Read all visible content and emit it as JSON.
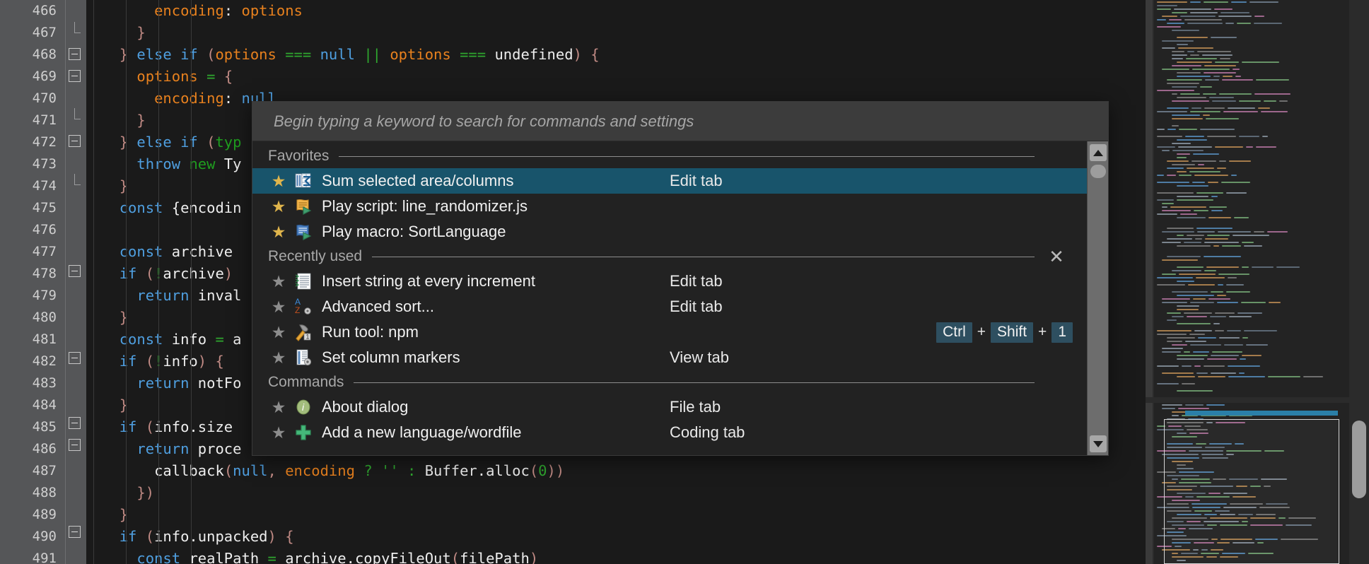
{
  "editor": {
    "first_line_number": 466,
    "lines": [
      {
        "n": 466,
        "fold": "none",
        "tokens": [
          {
            "t": "      ",
            "c": "plain"
          },
          {
            "t": "encoding",
            "c": "prop"
          },
          {
            "t": ": ",
            "c": "plain"
          },
          {
            "t": "options",
            "c": "prop"
          }
        ]
      },
      {
        "n": 467,
        "fold": "tick",
        "tokens": [
          {
            "t": "    ",
            "c": "plain"
          },
          {
            "t": "}",
            "c": "punc"
          }
        ]
      },
      {
        "n": 468,
        "fold": "box",
        "tokens": [
          {
            "t": "  ",
            "c": "plain"
          },
          {
            "t": "}",
            "c": "punc"
          },
          {
            "t": " ",
            "c": "plain"
          },
          {
            "t": "else",
            "c": "kw"
          },
          {
            "t": " ",
            "c": "plain"
          },
          {
            "t": "if",
            "c": "kw"
          },
          {
            "t": " ",
            "c": "plain"
          },
          {
            "t": "(",
            "c": "punc"
          },
          {
            "t": "options",
            "c": "prop"
          },
          {
            "t": " ",
            "c": "plain"
          },
          {
            "t": "===",
            "c": "op"
          },
          {
            "t": " ",
            "c": "plain"
          },
          {
            "t": "null",
            "c": "kw"
          },
          {
            "t": " ",
            "c": "plain"
          },
          {
            "t": "||",
            "c": "op"
          },
          {
            "t": " ",
            "c": "plain"
          },
          {
            "t": "options",
            "c": "prop"
          },
          {
            "t": " ",
            "c": "plain"
          },
          {
            "t": "===",
            "c": "op"
          },
          {
            "t": " ",
            "c": "plain"
          },
          {
            "t": "undefined",
            "c": "plain"
          },
          {
            "t": ")",
            "c": "punc"
          },
          {
            "t": " ",
            "c": "plain"
          },
          {
            "t": "{",
            "c": "punc"
          }
        ]
      },
      {
        "n": 469,
        "fold": "box",
        "tokens": [
          {
            "t": "    ",
            "c": "plain"
          },
          {
            "t": "options",
            "c": "prop"
          },
          {
            "t": " ",
            "c": "plain"
          },
          {
            "t": "=",
            "c": "op"
          },
          {
            "t": " ",
            "c": "plain"
          },
          {
            "t": "{",
            "c": "punc"
          }
        ]
      },
      {
        "n": 470,
        "fold": "none",
        "tokens": [
          {
            "t": "      ",
            "c": "plain"
          },
          {
            "t": "encoding",
            "c": "prop"
          },
          {
            "t": ": ",
            "c": "plain"
          },
          {
            "t": "null",
            "c": "kw"
          }
        ]
      },
      {
        "n": 471,
        "fold": "tick",
        "tokens": [
          {
            "t": "    ",
            "c": "plain"
          },
          {
            "t": "}",
            "c": "punc"
          }
        ]
      },
      {
        "n": 472,
        "fold": "box",
        "tokens": [
          {
            "t": "  ",
            "c": "plain"
          },
          {
            "t": "}",
            "c": "punc"
          },
          {
            "t": " ",
            "c": "plain"
          },
          {
            "t": "else",
            "c": "kw"
          },
          {
            "t": " ",
            "c": "plain"
          },
          {
            "t": "if",
            "c": "kw"
          },
          {
            "t": " ",
            "c": "plain"
          },
          {
            "t": "(",
            "c": "punc"
          },
          {
            "t": "typ",
            "c": "grn"
          }
        ]
      },
      {
        "n": 473,
        "fold": "none",
        "tokens": [
          {
            "t": "    ",
            "c": "plain"
          },
          {
            "t": "throw",
            "c": "kw"
          },
          {
            "t": " ",
            "c": "plain"
          },
          {
            "t": "new",
            "c": "grn"
          },
          {
            "t": " ",
            "c": "plain"
          },
          {
            "t": "Ty",
            "c": "plain"
          }
        ]
      },
      {
        "n": 474,
        "fold": "tick",
        "tokens": [
          {
            "t": "  ",
            "c": "plain"
          },
          {
            "t": "}",
            "c": "punc"
          }
        ]
      },
      {
        "n": 475,
        "fold": "none",
        "tokens": [
          {
            "t": "  ",
            "c": "plain"
          },
          {
            "t": "const",
            "c": "kw"
          },
          {
            "t": " ",
            "c": "plain"
          },
          {
            "t": "{encodin",
            "c": "plain"
          }
        ]
      },
      {
        "n": 476,
        "fold": "none",
        "tokens": []
      },
      {
        "n": 477,
        "fold": "none",
        "tokens": [
          {
            "t": "  ",
            "c": "plain"
          },
          {
            "t": "const",
            "c": "kw"
          },
          {
            "t": " ",
            "c": "plain"
          },
          {
            "t": "archive",
            "c": "plain"
          }
        ]
      },
      {
        "n": 478,
        "fold": "box",
        "tokens": [
          {
            "t": "  ",
            "c": "plain"
          },
          {
            "t": "if",
            "c": "kw"
          },
          {
            "t": " ",
            "c": "plain"
          },
          {
            "t": "(",
            "c": "punc"
          },
          {
            "t": "!",
            "c": "op"
          },
          {
            "t": "archive",
            "c": "plain"
          },
          {
            "t": ")",
            "c": "punc"
          }
        ]
      },
      {
        "n": 479,
        "fold": "none",
        "tokens": [
          {
            "t": "    ",
            "c": "plain"
          },
          {
            "t": "return",
            "c": "kw"
          },
          {
            "t": " ",
            "c": "plain"
          },
          {
            "t": "inval",
            "c": "plain"
          }
        ]
      },
      {
        "n": 480,
        "fold": "none",
        "tokens": [
          {
            "t": "  ",
            "c": "plain"
          },
          {
            "t": "}",
            "c": "punc"
          }
        ]
      },
      {
        "n": 481,
        "fold": "none",
        "tokens": [
          {
            "t": "  ",
            "c": "plain"
          },
          {
            "t": "const",
            "c": "kw"
          },
          {
            "t": " ",
            "c": "plain"
          },
          {
            "t": "info",
            "c": "plain"
          },
          {
            "t": " ",
            "c": "plain"
          },
          {
            "t": "=",
            "c": "op"
          },
          {
            "t": " ",
            "c": "plain"
          },
          {
            "t": "a",
            "c": "plain"
          }
        ]
      },
      {
        "n": 482,
        "fold": "box",
        "tokens": [
          {
            "t": "  ",
            "c": "plain"
          },
          {
            "t": "if",
            "c": "kw"
          },
          {
            "t": " ",
            "c": "plain"
          },
          {
            "t": "(",
            "c": "punc"
          },
          {
            "t": "!",
            "c": "op"
          },
          {
            "t": "info",
            "c": "plain"
          },
          {
            "t": ")",
            "c": "punc"
          },
          {
            "t": " ",
            "c": "plain"
          },
          {
            "t": "{",
            "c": "punc"
          }
        ]
      },
      {
        "n": 483,
        "fold": "none",
        "tokens": [
          {
            "t": "    ",
            "c": "plain"
          },
          {
            "t": "return",
            "c": "kw"
          },
          {
            "t": " ",
            "c": "plain"
          },
          {
            "t": "notFo",
            "c": "plain"
          }
        ]
      },
      {
        "n": 484,
        "fold": "none",
        "tokens": [
          {
            "t": "  ",
            "c": "plain"
          },
          {
            "t": "}",
            "c": "punc"
          }
        ]
      },
      {
        "n": 485,
        "fold": "box",
        "tokens": [
          {
            "t": "  ",
            "c": "plain"
          },
          {
            "t": "if",
            "c": "kw"
          },
          {
            "t": " ",
            "c": "plain"
          },
          {
            "t": "(",
            "c": "punc"
          },
          {
            "t": "info.size",
            "c": "plain"
          }
        ]
      },
      {
        "n": 486,
        "fold": "box",
        "tokens": [
          {
            "t": "    ",
            "c": "plain"
          },
          {
            "t": "return",
            "c": "kw"
          },
          {
            "t": " ",
            "c": "plain"
          },
          {
            "t": "proce",
            "c": "plain"
          }
        ]
      },
      {
        "n": 487,
        "fold": "none",
        "tokens": [
          {
            "t": "      ",
            "c": "plain"
          },
          {
            "t": "callback",
            "c": "plain"
          },
          {
            "t": "(",
            "c": "punc"
          },
          {
            "t": "null",
            "c": "kw"
          },
          {
            "t": ", ",
            "c": "punc"
          },
          {
            "t": "encoding",
            "c": "prop"
          },
          {
            "t": " ",
            "c": "plain"
          },
          {
            "t": "?",
            "c": "op"
          },
          {
            "t": " ",
            "c": "plain"
          },
          {
            "t": "''",
            "c": "str"
          },
          {
            "t": " ",
            "c": "plain"
          },
          {
            "t": ":",
            "c": "op"
          },
          {
            "t": " ",
            "c": "plain"
          },
          {
            "t": "Buffer.alloc",
            "c": "plain"
          },
          {
            "t": "(",
            "c": "punc"
          },
          {
            "t": "0",
            "c": "num"
          },
          {
            "t": "))",
            "c": "punc"
          }
        ]
      },
      {
        "n": 488,
        "fold": "none",
        "tokens": [
          {
            "t": "    ",
            "c": "plain"
          },
          {
            "t": "})",
            "c": "punc"
          }
        ]
      },
      {
        "n": 489,
        "fold": "none",
        "tokens": [
          {
            "t": "  ",
            "c": "plain"
          },
          {
            "t": "}",
            "c": "punc"
          }
        ]
      },
      {
        "n": 490,
        "fold": "box",
        "tokens": [
          {
            "t": "  ",
            "c": "plain"
          },
          {
            "t": "if",
            "c": "kw"
          },
          {
            "t": " ",
            "c": "plain"
          },
          {
            "t": "(",
            "c": "punc"
          },
          {
            "t": "info.unpacked",
            "c": "plain"
          },
          {
            "t": ")",
            "c": "punc"
          },
          {
            "t": " ",
            "c": "plain"
          },
          {
            "t": "{",
            "c": "punc"
          }
        ]
      },
      {
        "n": 491,
        "fold": "none",
        "tokens": [
          {
            "t": "    ",
            "c": "plain"
          },
          {
            "t": "const",
            "c": "kw"
          },
          {
            "t": " ",
            "c": "plain"
          },
          {
            "t": "realPath",
            "c": "plain"
          },
          {
            "t": " ",
            "c": "plain"
          },
          {
            "t": "=",
            "c": "op"
          },
          {
            "t": " ",
            "c": "plain"
          },
          {
            "t": "archive.copyFileOut",
            "c": "plain"
          },
          {
            "t": "(",
            "c": "punc"
          },
          {
            "t": "filePath",
            "c": "plain"
          },
          {
            "t": ")",
            "c": "punc"
          }
        ]
      }
    ]
  },
  "palette": {
    "search": {
      "placeholder": "Begin typing a keyword to search for commands and settings",
      "value": ""
    },
    "sections": [
      {
        "label": "Favorites",
        "has_close": false,
        "items": [
          {
            "label": "Sum selected area/columns",
            "tab": "Edit tab",
            "favorite": true,
            "selected": true,
            "icon": "sum-columns-icon",
            "keys": []
          },
          {
            "label": "Play script: line_randomizer.js",
            "tab": "",
            "favorite": true,
            "selected": false,
            "icon": "script-play-icon",
            "keys": []
          },
          {
            "label": "Play macro: SortLanguage",
            "tab": "",
            "favorite": true,
            "selected": false,
            "icon": "macro-play-icon",
            "keys": []
          }
        ]
      },
      {
        "label": "Recently used",
        "has_close": true,
        "close_label": "✕",
        "items": [
          {
            "label": "Insert string at every increment",
            "tab": "Edit tab",
            "favorite": false,
            "selected": false,
            "icon": "insert-string-icon",
            "keys": []
          },
          {
            "label": "Advanced sort...",
            "tab": "Edit tab",
            "favorite": false,
            "selected": false,
            "icon": "advanced-sort-icon",
            "keys": []
          },
          {
            "label": "Run tool: npm",
            "tab": "",
            "favorite": false,
            "selected": false,
            "icon": "run-tool-icon",
            "keys": [
              "Ctrl",
              "Shift",
              "1"
            ]
          },
          {
            "label": "Set column markers",
            "tab": "View tab",
            "favorite": false,
            "selected": false,
            "icon": "column-markers-icon",
            "keys": []
          }
        ]
      },
      {
        "label": "Commands",
        "has_close": false,
        "items": [
          {
            "label": "About dialog",
            "tab": "File tab",
            "favorite": false,
            "selected": false,
            "icon": "info-icon",
            "keys": []
          },
          {
            "label": "Add a new language/wordfile",
            "tab": "Coding tab",
            "favorite": false,
            "selected": false,
            "icon": "plus-icon",
            "keys": []
          }
        ]
      }
    ],
    "key_separator": "+",
    "scrollbar": {
      "up_arrow": "▲",
      "down_arrow": "▼"
    }
  },
  "colors": {
    "selection": "#18546b",
    "favorite_star": "#e0b54c",
    "inactive_star": "#8d8d8d",
    "key_badge": "#2e4f60",
    "palette_bg": "#222222",
    "search_bg": "#3c3c3c",
    "editor_bg": "#1a1a1a",
    "gutter_bg": "#555658"
  }
}
